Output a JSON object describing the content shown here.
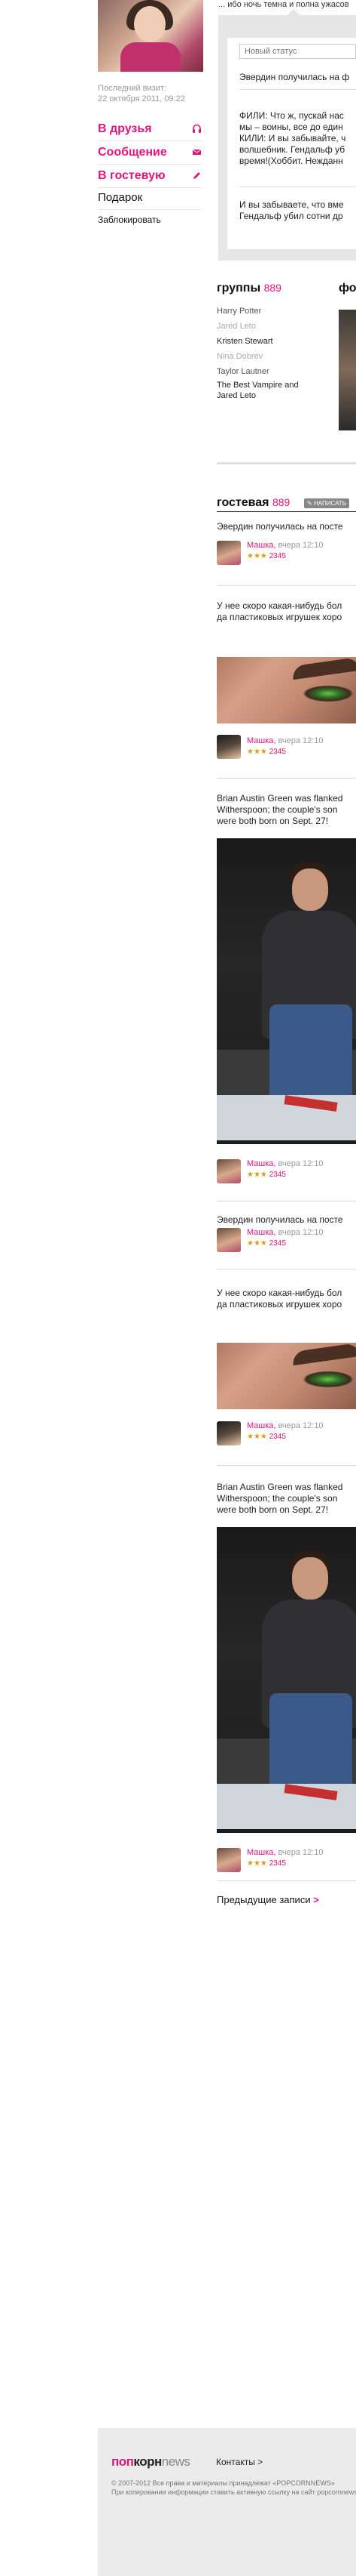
{
  "profile": {
    "last_visit_label": "Последний визит:",
    "last_visit_date": "22 октября 2011, 09:22"
  },
  "side_menu": {
    "friends": "В друзья",
    "message": "Сообщение",
    "guestbook": "В гостевую",
    "gift": "Подарок",
    "block": "Заблокировать"
  },
  "status": {
    "top_line": "... ибо ночь темна и полна ужасов",
    "placeholder": "Новый статус",
    "entries": [
      "Эвердин получилась на ф",
      "ФИЛИ: Что ж, пускай нас",
      "мы – воины, все до един",
      "КИЛИ: И вы забывайте, ч",
      "волшебник. Гендальф уб",
      "время!(Хоббит. Нежданн",
      "И вы забываете, что вме",
      "Гендальф убил сотни др"
    ]
  },
  "groups": {
    "title": "группы",
    "count": "889",
    "items": [
      "Harry Potter",
      "Jared Leto",
      "Kristen Stewart",
      "Nina Dobrev",
      "Taylor Lautner",
      "The Best Vampire and Jared Leto"
    ],
    "photos_title": "фот"
  },
  "guestbook": {
    "title": "гостевая",
    "count": "889",
    "write_label": "НАПИСАТЬ",
    "posts": [
      {
        "text": "Эвердин получилась на посте"
      },
      {
        "text": [
          "У нее скоро какая-нибудь бол",
          "да пластиковых игрушек хоро"
        ]
      },
      {
        "text": [
          "Brian Austin Green was flanked",
          "Witherspoon; the couple's son",
          "were both born on Sept. 27!"
        ]
      },
      {
        "text": "Эвердин получилась на посте"
      },
      {
        "text": [
          "У нее скоро какая-нибудь бол",
          "да пластиковых игрушек хоро"
        ]
      },
      {
        "text": [
          "Brian Austin Green was flanked",
          "Witherspoon; the couple's son",
          "were both born on Sept. 27!"
        ]
      }
    ],
    "author": {
      "name": "Машка,",
      "when": "вчера 12:10",
      "stars": "★★★",
      "points": "2345"
    },
    "prev_label": "Предыдущие записи",
    "prev_arrow": ">"
  },
  "footer": {
    "logo_pop": "поп",
    "logo_korn": "корн",
    "logo_news": "news",
    "contacts": "Контакты >",
    "copyright": "© 2007-2012 Все права и материалы принадлежат «POPCORNNEWS»",
    "notice": "При копировании информации ставить активную ссылку на сайт popcornnews.ru"
  }
}
